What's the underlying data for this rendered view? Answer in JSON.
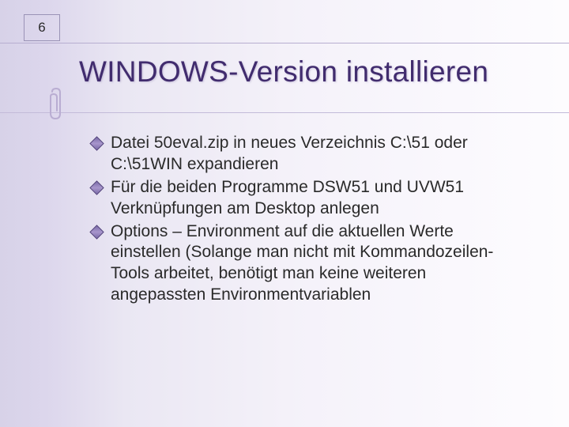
{
  "page_number": "6",
  "title": "WINDOWS-Version installieren",
  "bullets": [
    "Datei 50eval.zip in neues Verzeichnis C:\\51 oder C:\\51WIN expandieren",
    "Für die beiden Programme DSW51 und UVW51 Verknüpfungen am Desktop anlegen",
    "Options – Environment auf die aktuellen Werte einstellen (Solange man nicht mit Kommandozeilen-Tools arbeitet, benötigt man keine weiteren angepassten Environmentvariablen"
  ]
}
